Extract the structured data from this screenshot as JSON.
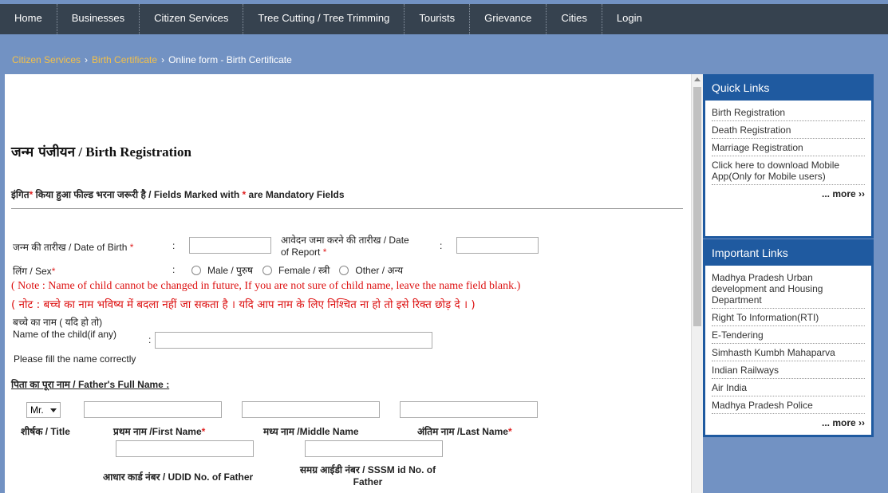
{
  "nav": {
    "items": [
      "Home",
      "Businesses",
      "Citizen Services",
      "Tree Cutting / Tree Trimming",
      "Tourists",
      "Grievance",
      "Cities",
      "Login"
    ]
  },
  "breadcrumb": {
    "level1": "Citizen Services",
    "level2": "Birth Certificate",
    "current": "Online form - Birth Certificate",
    "separator": "›"
  },
  "form": {
    "title_hi": "जन्म पंजीयन",
    "title_en": " / Birth Registration",
    "mandatory_prefix": "इंगित",
    "mandatory_mid": " किया हुआ फील्ड भरना जरूरी है / Fields Marked with ",
    "mandatory_suffix": " are Mandatory Fields",
    "star": "*",
    "colon": ":",
    "dob_label": "जन्म की तारीख / Date of Birth",
    "dob_value": "",
    "report_label_line1": "आवेदन जमा करने की तारीख / Date",
    "report_label_line2": "of Report",
    "report_value": "",
    "sex_label": "लिंग / Sex",
    "sex_options": [
      "Male / पुरुष",
      "Female / स्त्री",
      "Other / अन्य"
    ],
    "note_en": "( Note : Name of child cannot be changed in future, If you are not sure of child name, leave the name field blank.)",
    "note_hi": "( नोट : बच्चे का नाम भविष्य में बदला नहीं जा सकता है । यदि आप नाम के लिए निश्चित ना हो तो इसे रिक्त छोड़ दे । )",
    "child_label_hi": "बच्चे का नाम ( यदि हो तो)",
    "child_label_en": "Name of the child(if any)",
    "child_value": "",
    "child_hint": "Please fill the name correctly",
    "father_heading": "पिता का पूरा नाम / Father's Full Name :",
    "title_select": "Mr.",
    "cap_title": "शीर्षक / Title",
    "cap_first": "प्रथम नाम /First Name",
    "cap_middle": "मध्य नाम /Middle Name",
    "cap_last": "अंतिम नाम /Last Name",
    "cap_udid": "आधार कार्ड नंबर / UDID No. of Father",
    "cap_sssm_line1": "समग्र आईडी नंबर / SSSM id No. of",
    "cap_sssm_line2": "Father"
  },
  "quick_links": {
    "title": "Quick Links",
    "items": [
      "Birth Registration",
      "Death Registration",
      "Marriage Registration",
      "Click here to download Mobile App(Only for Mobile users)"
    ],
    "more": "... more ››"
  },
  "important_links": {
    "title": "Important Links",
    "items": [
      "Madhya Pradesh Urban development and Housing Department",
      "Right To Information(RTI)",
      "E-Tendering",
      "Simhasth Kumbh Mahaparva",
      "Indian Railways",
      "Air India",
      "Madhya Pradesh Police"
    ],
    "more": "... more ››"
  },
  "colors": {
    "nav_bg": "#36424f",
    "page_bg": "#7292c3",
    "accent": "#1f5aa0",
    "required_star": "#e02020",
    "note_red": "#d11111",
    "breadcrumb_link": "#f3c04a"
  }
}
